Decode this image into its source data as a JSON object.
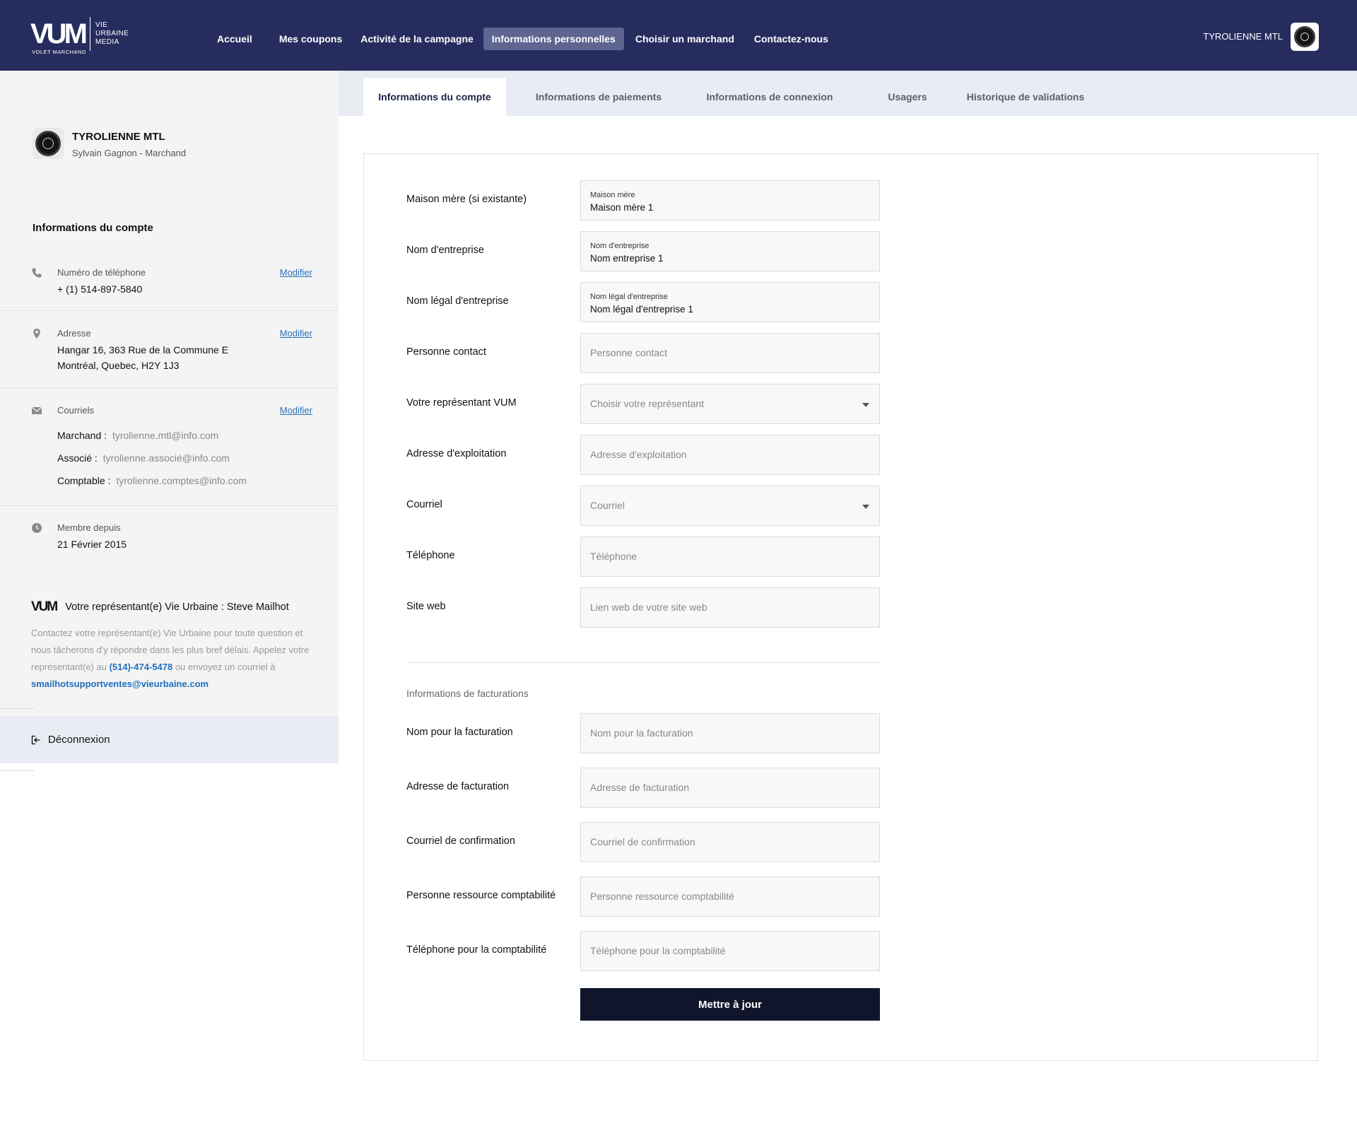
{
  "brand": {
    "mark": "VUM",
    "words": [
      "VIE",
      "URBAINE",
      "MEDIA"
    ],
    "subtitle": "VOLET MARCHAND"
  },
  "nav": {
    "items": [
      {
        "label": "Accueil"
      },
      {
        "label": "Mes coupons"
      },
      {
        "label": "Activité de la campagne"
      },
      {
        "label": "Informations personnelles",
        "active": true
      },
      {
        "label": "Choisir un marchand"
      },
      {
        "label": "Contactez-nous"
      }
    ],
    "user_name": "TYROLIENNE MTL"
  },
  "sidebar": {
    "company_name": "TYROLIENNE MTL",
    "company_role": "Sylvain Gagnon - Marchand",
    "section_title": "Informations du compte",
    "phone": {
      "label": "Numéro de téléphone",
      "value": "+ (1) 514-897-5840",
      "action": "Modifier",
      "icon": "phone-icon"
    },
    "address": {
      "label": "Adresse",
      "line1": "Hangar 16, 363 Rue de la Commune E",
      "line2": "Montréal, Quebec, H2Y 1J3",
      "action": "Modifier",
      "icon": "location-pin-icon"
    },
    "emails": {
      "label": "Courriels",
      "action": "Modifier",
      "icon": "envelope-icon",
      "rows": [
        {
          "key": "Marchand :",
          "value": "tyrolienne.mtl@info.com"
        },
        {
          "key": "Associé :",
          "value": "tyrolienne.associé@info.com"
        },
        {
          "key": "Comptable :",
          "value": "tyrolienne.comptes@info.com"
        }
      ]
    },
    "member": {
      "label": "Membre depuis",
      "value": "21 Février 2015",
      "icon": "clock-icon"
    },
    "rep": {
      "mark": "VUM",
      "title": "Votre représentant(e) Vie Urbaine : Steve Mailhot",
      "text_1": "Contactez votre représentant(e) Vie Urbaine pour toute question et nous tâcherons d'y répondre dans les plus bref délais. Appelez votre représentant(e) au",
      "phone": "(514)-474-5478",
      "text_2": "ou envoyez un courriel à",
      "email": "smailhotsupportventes@vieurbaine.com"
    },
    "logout": "Déconnexion"
  },
  "tabs": [
    {
      "label": "Informations du compte",
      "active": true
    },
    {
      "label": "Informations de paiements"
    },
    {
      "label": "Informations de connexion"
    },
    {
      "label": "Usagers"
    },
    {
      "label": "Historique de validations"
    }
  ],
  "form": {
    "rows": [
      {
        "label": "Maison mère (si existante)",
        "float_label": "Maison mère",
        "value": "Maison mère 1"
      },
      {
        "label": "Nom d'entreprise",
        "float_label": "Nom d'entreprise",
        "value": "Nom entreprise 1"
      },
      {
        "label": "Nom légal d'entreprise",
        "float_label": "Nom légal d'entreprise",
        "value": "Nom légal d'entreprise 1"
      },
      {
        "label": "Personne contact",
        "placeholder": "Personne contact"
      },
      {
        "label": "Votre représentant VUM",
        "placeholder": "Choisir votre représentant",
        "select": true
      },
      {
        "label": "Adresse d'exploitation",
        "placeholder": "Adresse d'exploitation"
      },
      {
        "label": "Courriel",
        "placeholder": "Courriel",
        "select": true
      },
      {
        "label": "Téléphone",
        "placeholder": "Téléphone"
      },
      {
        "label": "Site web",
        "placeholder": "Lien web de votre site web"
      }
    ],
    "billing_title": "Informations de facturations",
    "billing_rows": [
      {
        "label": "Nom pour la facturation",
        "placeholder": "Nom pour la facturation"
      },
      {
        "label": "Adresse de facturation",
        "placeholder": "Adresse de facturation"
      },
      {
        "label": "Courriel de confirmation",
        "placeholder": "Courriel de confirmation"
      },
      {
        "label": "Personne ressource comptabilité",
        "placeholder": "Personne ressource comptabilité"
      },
      {
        "label": "Téléphone pour la comptabilité",
        "placeholder": "Téléphone pour la comptabilité"
      }
    ],
    "submit": "Mettre à jour"
  },
  "colors": {
    "nav_bg": "#262d5e",
    "nav_active": "#5d6590",
    "tabs_bg": "#e8ecf3",
    "link": "#2a6fb8",
    "submit_bg": "#11152c"
  }
}
